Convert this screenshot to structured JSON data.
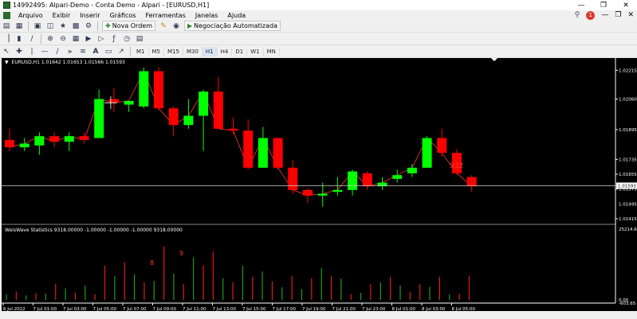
{
  "window": {
    "title": "14992495: Alpari-Demo - Conta Demo - Alpari - [EURUSD,H1]"
  },
  "menu": {
    "items": [
      "Arquivo",
      "Exibir",
      "Inserir",
      "Gráficos",
      "Ferramentas",
      "Janelas",
      "Ajuda"
    ],
    "notification_count": "1"
  },
  "toolbar": {
    "new_order_label": "Nova Ordem",
    "auto_trading_label": "Negociação Automatizada"
  },
  "timeframes": [
    "M1",
    "M5",
    "M15",
    "M30",
    "H1",
    "H4",
    "D1",
    "W1",
    "MN"
  ],
  "timeframe_active": "H1",
  "chart": {
    "symbol_label": "EURUSD,H1  1.01642 1.01653 1.01566 1.01593",
    "current_price": "1.01593",
    "price_labels": [
      "1.02215",
      "1.02060",
      "1.01895",
      "1.01735",
      "1.01655",
      "1.01575",
      "1.01415"
    ],
    "price_label_secondary": "1.01495",
    "price_label_bottom": "1.01415",
    "annotation": "932",
    "colors": {
      "bull": "#00ff00",
      "bear": "#ff0000",
      "background": "#000000"
    }
  },
  "indicator": {
    "label": "WeisWave Statistics 9318.00000 -1.00000 -1.00000 -1.00000 9318.00000",
    "scale_top": "25214.65",
    "scale_bottom": "0.00",
    "scale_bottom_alt": "-603.65",
    "annotations": [
      "8",
      "9"
    ]
  },
  "time_axis": [
    "6 Jul 2022",
    "7 Jul 01:00",
    "7 Jul 03:00",
    "7 Jul 05:00",
    "7 Jul 07:00",
    "7 Jul 09:00",
    "7 Jul 11:00",
    "7 Jul 13:00",
    "7 Jul 15:00",
    "7 Jul 17:00",
    "7 Jul 19:00",
    "7 Jul 21:00",
    "7 Jul 23:00",
    "8 Jul 01:00",
    "8 Jul 03:00",
    "8 Jul 05:00"
  ],
  "chart_data": [
    {
      "type": "candlestick",
      "title": "EURUSD,H1",
      "ylim": [
        1.01415,
        1.02255
      ],
      "candles": [
        {
          "o": 1.0184,
          "h": 1.019,
          "l": 1.0178,
          "c": 1.018
        },
        {
          "o": 1.018,
          "h": 1.0185,
          "l": 1.0178,
          "c": 1.0182
        },
        {
          "o": 1.0181,
          "h": 1.0188,
          "l": 1.0176,
          "c": 1.0186
        },
        {
          "o": 1.0186,
          "h": 1.0188,
          "l": 1.018,
          "c": 1.0183
        },
        {
          "o": 1.0183,
          "h": 1.0188,
          "l": 1.0178,
          "c": 1.0186
        },
        {
          "o": 1.0186,
          "h": 1.0188,
          "l": 1.0182,
          "c": 1.0184
        },
        {
          "o": 1.0185,
          "h": 1.0211,
          "l": 1.0185,
          "c": 1.0206
        },
        {
          "o": 1.0206,
          "h": 1.0212,
          "l": 1.0199,
          "c": 1.0204
        },
        {
          "o": 1.0203,
          "h": 1.0205,
          "l": 1.0199,
          "c": 1.0205
        },
        {
          "o": 1.0202,
          "h": 1.0223,
          "l": 1.0201,
          "c": 1.0221
        },
        {
          "o": 1.0221,
          "h": 1.0223,
          "l": 1.02,
          "c": 1.0201
        },
        {
          "o": 1.0201,
          "h": 1.0202,
          "l": 1.0186,
          "c": 1.0192
        },
        {
          "o": 1.0192,
          "h": 1.0206,
          "l": 1.019,
          "c": 1.0197
        },
        {
          "o": 1.0197,
          "h": 1.0211,
          "l": 1.0178,
          "c": 1.021
        },
        {
          "o": 1.021,
          "h": 1.0218,
          "l": 1.019,
          "c": 1.019
        },
        {
          "o": 1.019,
          "h": 1.0196,
          "l": 1.0187,
          "c": 1.0189
        },
        {
          "o": 1.0189,
          "h": 1.0195,
          "l": 1.0168,
          "c": 1.0169
        },
        {
          "o": 1.0169,
          "h": 1.0191,
          "l": 1.0169,
          "c": 1.0185
        },
        {
          "o": 1.0185,
          "h": 1.0185,
          "l": 1.0168,
          "c": 1.0169
        },
        {
          "o": 1.0169,
          "h": 1.0173,
          "l": 1.0155,
          "c": 1.0157
        },
        {
          "o": 1.0157,
          "h": 1.0158,
          "l": 1.015,
          "c": 1.0154
        },
        {
          "o": 1.0154,
          "h": 1.0161,
          "l": 1.0148,
          "c": 1.0155
        },
        {
          "o": 1.0156,
          "h": 1.0164,
          "l": 1.0154,
          "c": 1.0157
        },
        {
          "o": 1.0157,
          "h": 1.0168,
          "l": 1.0154,
          "c": 1.0167
        },
        {
          "o": 1.0166,
          "h": 1.0167,
          "l": 1.0157,
          "c": 1.0159
        },
        {
          "o": 1.0159,
          "h": 1.0164,
          "l": 1.0157,
          "c": 1.0161
        },
        {
          "o": 1.0163,
          "h": 1.0168,
          "l": 1.0161,
          "c": 1.0165
        },
        {
          "o": 1.0166,
          "h": 1.0171,
          "l": 1.0164,
          "c": 1.0169
        },
        {
          "o": 1.0169,
          "h": 1.0186,
          "l": 1.0169,
          "c": 1.0185
        },
        {
          "o": 1.0185,
          "h": 1.019,
          "l": 1.0175,
          "c": 1.0177
        },
        {
          "o": 1.0177,
          "h": 1.0179,
          "l": 1.0165,
          "c": 1.0166
        },
        {
          "o": 1.0164,
          "h": 1.0165,
          "l": 1.0156,
          "c": 1.0159
        }
      ]
    },
    {
      "type": "bar",
      "title": "WeisWave Statistics",
      "ylim": [
        -603.65,
        25214.65
      ],
      "values": [
        2200,
        3200,
        1800,
        2600,
        2400,
        6200,
        4500,
        2800,
        5600,
        2200,
        13200,
        9200,
        14500,
        9800,
        6800,
        7400,
        20600,
        10200,
        6200,
        16400,
        13200,
        18700,
        8400,
        6900,
        13200,
        8900,
        11000,
        7200,
        4900,
        9300,
        4200,
        8400,
        12400,
        9300,
        8200,
        2300,
        2700,
        6100,
        6800,
        9000,
        5600,
        3100,
        6100,
        5100,
        8900,
        2200,
        2400,
        9300
      ],
      "colors": [
        "g",
        "r",
        "g",
        "r",
        "g",
        "r",
        "g",
        "r",
        "g",
        "r",
        "r",
        "g",
        "r",
        "g",
        "r",
        "g",
        "r",
        "g",
        "r",
        "g",
        "r",
        "r",
        "g",
        "r",
        "g",
        "r",
        "g",
        "r",
        "g",
        "r",
        "g",
        "r",
        "g",
        "r",
        "g",
        "r",
        "g",
        "r",
        "g",
        "r",
        "g",
        "r",
        "r",
        "g",
        "r",
        "g",
        "r",
        "r"
      ]
    }
  ]
}
